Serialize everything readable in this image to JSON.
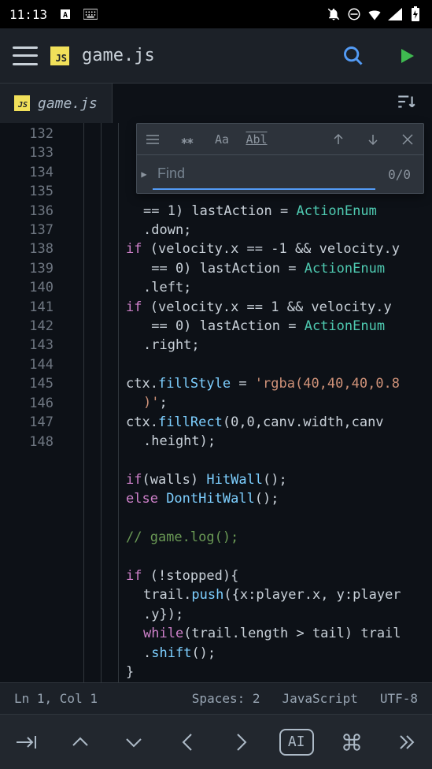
{
  "status": {
    "time": "11:13"
  },
  "header": {
    "filename": "game.js"
  },
  "tab": {
    "filename": "game.js"
  },
  "find": {
    "placeholder": "Find",
    "count": "0/0"
  },
  "gutter": [
    "132",
    "",
    "",
    "133",
    "",
    "134",
    "",
    "",
    "135",
    "",
    "",
    "136",
    "137",
    "",
    "138",
    "",
    "139",
    "140",
    "141",
    "142",
    "143",
    "144",
    "145",
    "146",
    "",
    "147",
    "",
    "148"
  ],
  "code": {
    "l132a": "== 1) lastAction = ",
    "l132a_type": "ActionEnum",
    "l132b": ".down;",
    "l134if": "if",
    "l134a": " (velocity.x == -1 && velocity.y",
    "l134b": " == 0) lastAction = ",
    "l134type": "ActionEnum",
    "l134c": ".left;",
    "l135if": "if",
    "l135a": " (velocity.x == 1 && velocity.y",
    "l135b": " == 0) lastAction = ",
    "l135type": "ActionEnum",
    "l135c": ".right;",
    "l137a": "ctx.",
    "l137b": "fillStyle",
    "l137c": " = ",
    "l137str": "'rgba(40,40,40,0.8",
    "l137str2": ")'",
    "l137d": ";",
    "l138a": "ctx.",
    "l138b": "fillRect",
    "l138c": "(0,0,canv.width,canv",
    "l138d": ".height);",
    "l140if": "if",
    "l140a": "(walls) ",
    "l140fn": "HitWall",
    "l140b": "();",
    "l141else": "else",
    "l141fn": " DontHitWall",
    "l141b": "();",
    "l143": "// game.log();",
    "l145if": "if",
    "l145a": " (!stopped){",
    "l146a": "trail.",
    "l146b": "push",
    "l146c": "({x:player.x, y:player",
    "l146d": ".y});",
    "l147while": "while",
    "l147a": "(trail.length > tail) trail",
    "l147b": ".",
    "l147fn": "shift",
    "l147c": "();",
    "l148": "}"
  },
  "statusbar": {
    "pos": "Ln 1, Col 1",
    "spaces": "Spaces: 2",
    "lang": "JavaScript",
    "enc": "UTF-8"
  },
  "bottombar": {
    "ai": "AI"
  }
}
